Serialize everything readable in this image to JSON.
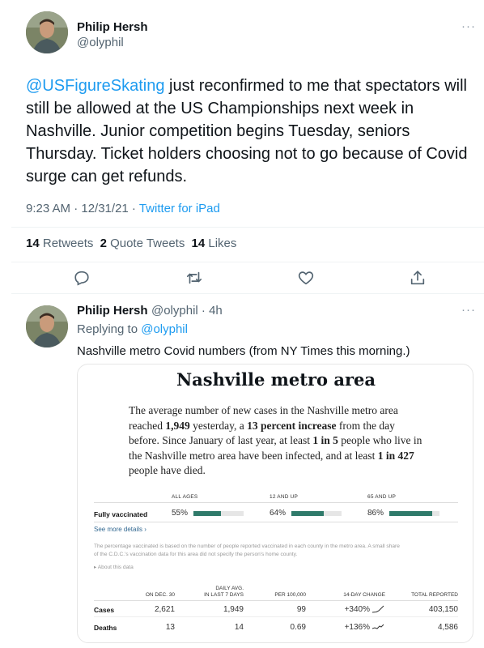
{
  "tweet": {
    "author_name": "Philip Hersh",
    "author_handle": "@olyphil",
    "mention": "@USFigureSkating",
    "body": " just reconfirmed to me that spectators will still be allowed at the US Championships next week in Nashville.  Junior competition begins Tuesday, seniors Thursday.  Ticket holders choosing not to go because of Covid surge can get refunds.",
    "timestamp": "9:23 AM · 12/31/21 · ",
    "source": "Twitter for iPad",
    "retweets_count": "14",
    "retweets_label": " Retweets",
    "quotes_count": "2",
    "quotes_label": " Quote Tweets",
    "likes_count": "14",
    "likes_label": " Likes",
    "more_menu": "···"
  },
  "actions": {
    "icons": [
      "reply-icon",
      "retweet-icon",
      "like-icon",
      "share-icon"
    ]
  },
  "reply": {
    "author_name": "Philip Hersh",
    "author_handle": "@olyphil · 4h",
    "replying_to_prefix": "Replying to ",
    "replying_to_handle": "@olyphil",
    "body": "Nashville metro Covid numbers (from NY Times this morning.)",
    "more_menu": "···"
  },
  "card": {
    "title": "Nashville metro area",
    "para_1": "The average number of new cases in the Nashville metro area reached ",
    "para_b1": "1,949",
    "para_2": " yesterday, a ",
    "para_b2": "13 percent increase",
    "para_3": " from the day before. Since January of last year, at least ",
    "para_b3": "1 in 5",
    "para_4": " people who live in the Nashville metro area have been infected, and at least ",
    "para_b4": "1 in 427",
    "para_5": " people have died.",
    "vacc": {
      "headers": [
        "ALL AGES",
        "12 AND UP",
        "65 AND UP"
      ],
      "row_label": "Fully vaccinated",
      "values": [
        "55%",
        "64%",
        "86%"
      ],
      "fractions": [
        0.55,
        0.64,
        0.86
      ]
    },
    "see_more": "See more details ›",
    "note": "The percentage vaccinated is based on the number of people reported vaccinated in each county in the metro area. A small share of the C.D.C.'s vaccination data for this area did not specify the person's home county.",
    "about": "▸ About this data",
    "table": {
      "headers": [
        "ON DEC. 30",
        "DAILY AVG.\nIN LAST 7 DAYS",
        "PER 100,000",
        "14-DAY CHANGE",
        "TOTAL REPORTED"
      ],
      "rows": [
        {
          "label": "Cases",
          "cells": [
            "2,621",
            "1,949",
            "99",
            "+340%",
            "403,150"
          ]
        },
        {
          "label": "Deaths",
          "cells": [
            "13",
            "14",
            "0.69",
            "+136%",
            "4,586"
          ]
        }
      ]
    }
  },
  "colors": {
    "link": "#1d9bf0",
    "bar_fill": "#2f7a6a",
    "bar_track": "#e6e6e6"
  }
}
